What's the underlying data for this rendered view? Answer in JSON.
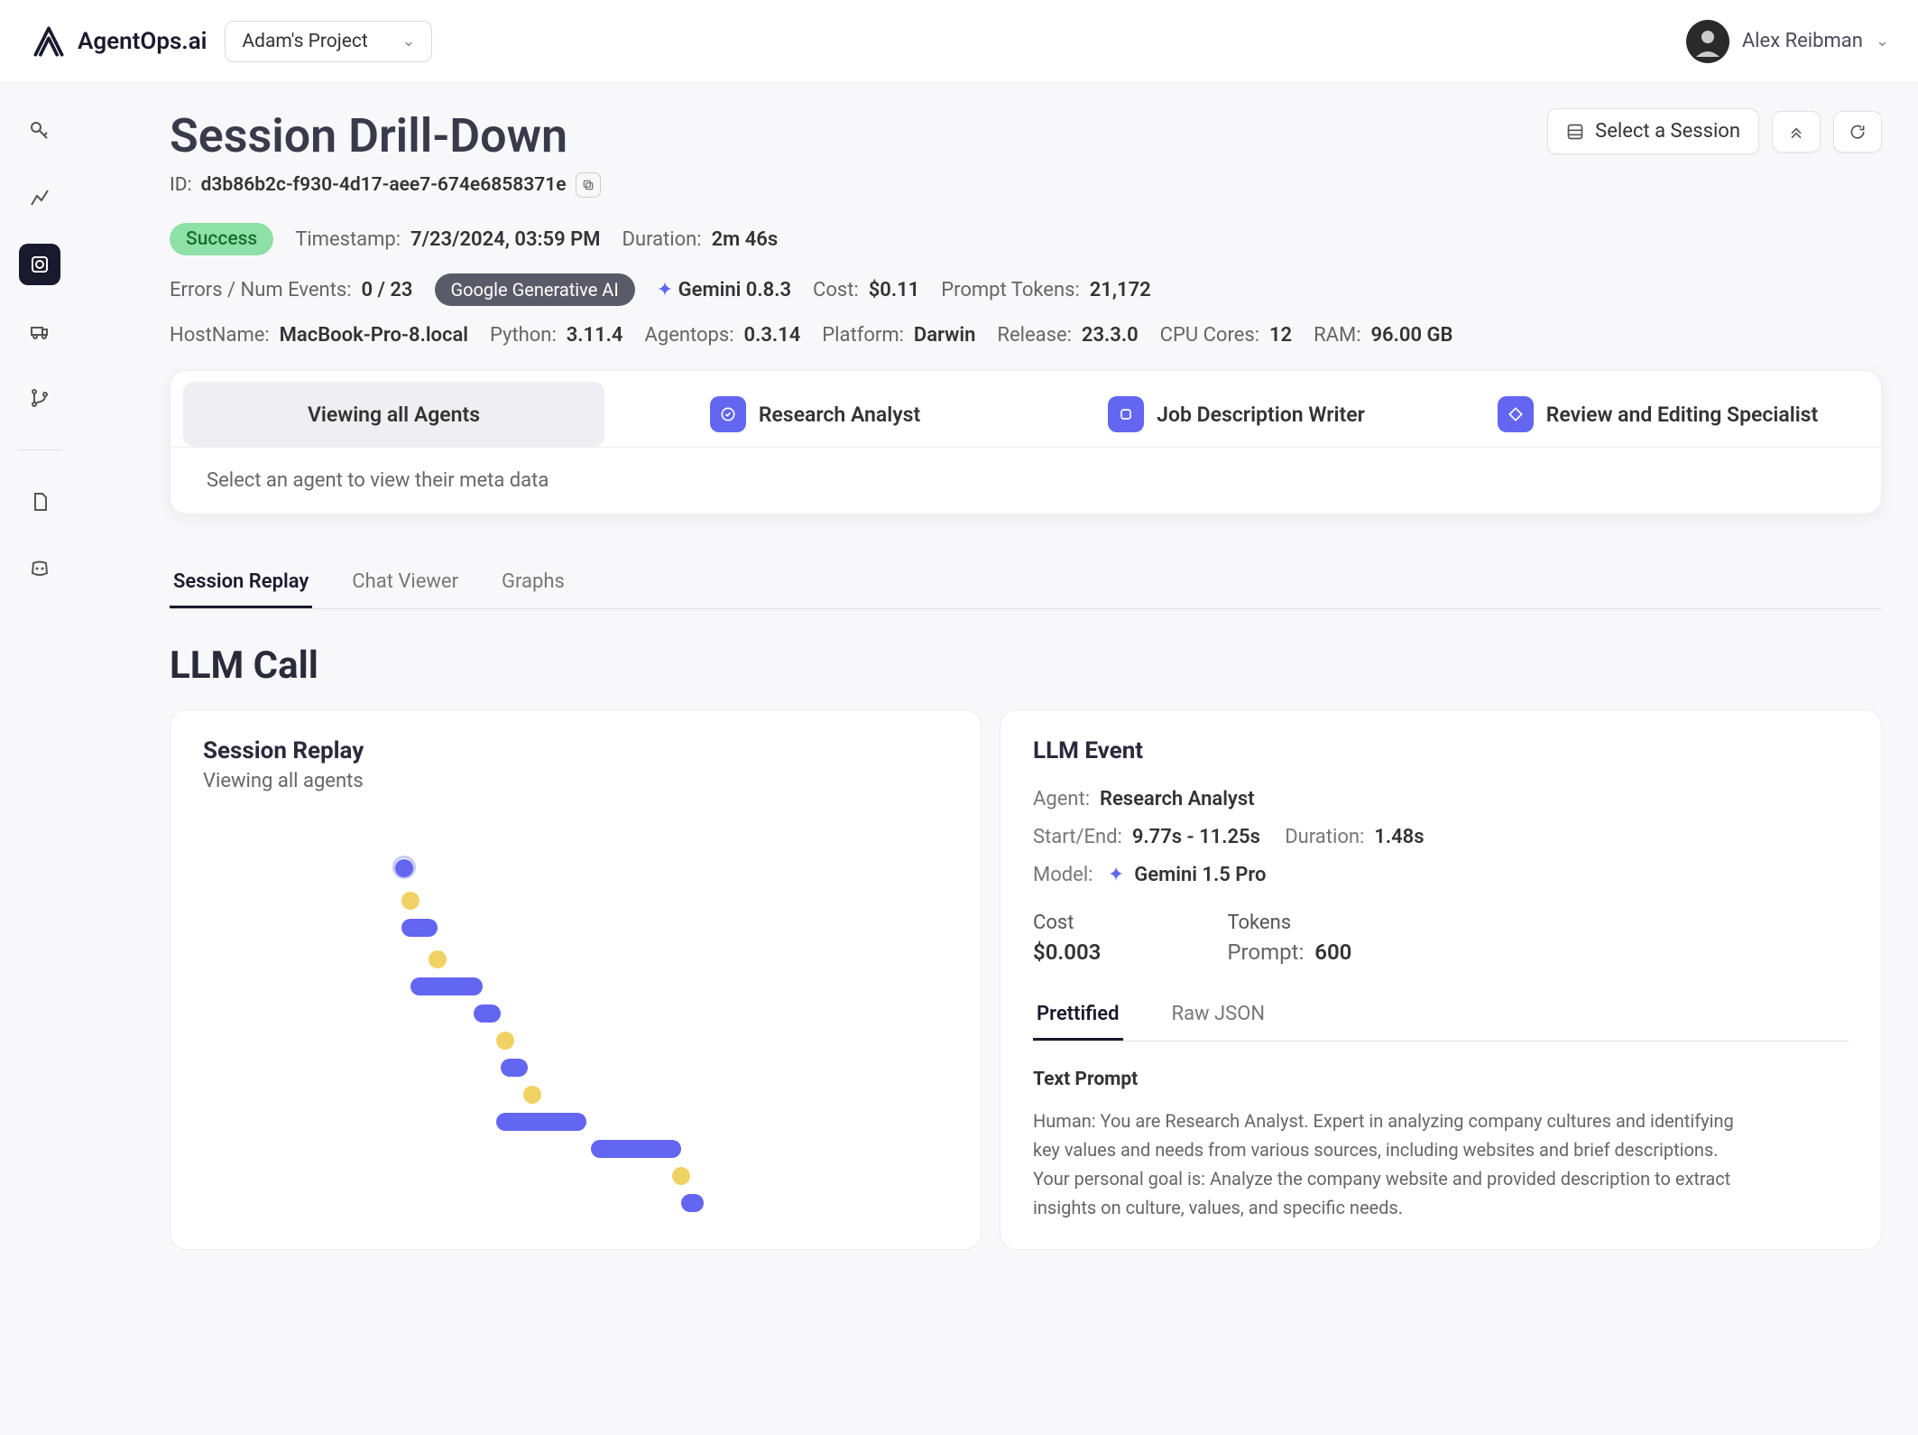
{
  "brand": "AgentOps.ai",
  "project": "Adam's Project",
  "user": "Alex Reibman",
  "page": {
    "title": "Session Drill-Down",
    "id_label": "ID:",
    "id_value": "d3b86b2c-f930-4d17-aee7-674e6858371e",
    "select_session": "Select a Session"
  },
  "status": {
    "badge": "Success",
    "timestamp_label": "Timestamp:",
    "timestamp": "7/23/2024, 03:59 PM",
    "duration_label": "Duration:",
    "duration": "2m 46s"
  },
  "metrics": {
    "errors_label": "Errors / Num Events:",
    "errors": "0 / 23",
    "provider": "Google Generative AI",
    "model": "Gemini 0.8.3",
    "cost_label": "Cost:",
    "cost": "$0.11",
    "prompt_tokens_label": "Prompt Tokens:",
    "prompt_tokens": "21,172"
  },
  "env": {
    "hostname_label": "HostName:",
    "hostname": "MacBook-Pro-8.local",
    "python_label": "Python:",
    "python": "3.11.4",
    "agentops_label": "Agentops:",
    "agentops": "0.3.14",
    "platform_label": "Platform:",
    "platform": "Darwin",
    "release_label": "Release:",
    "release": "23.3.0",
    "cpu_label": "CPU Cores:",
    "cpu": "12",
    "ram_label": "RAM:",
    "ram": "96.00 GB"
  },
  "agents": {
    "all": "Viewing all Agents",
    "a1": "Research Analyst",
    "a2": "Job Description Writer",
    "a3": "Review and Editing Specialist",
    "hint": "Select an agent to view their meta data"
  },
  "subtabs": {
    "t1": "Session Replay",
    "t2": "Chat Viewer",
    "t3": "Graphs"
  },
  "section": "LLM Call",
  "replay": {
    "title": "Session Replay",
    "subtitle": "Viewing all agents"
  },
  "event": {
    "title": "LLM Event",
    "agent_label": "Agent:",
    "agent": "Research Analyst",
    "startend_label": "Start/End:",
    "startend": "9.77s - 11.25s",
    "duration_label": "Duration:",
    "duration": "1.48s",
    "model_label": "Model:",
    "model": "Gemini 1.5 Pro",
    "cost_label": "Cost",
    "cost": "$0.003",
    "tokens_label": "Tokens",
    "prompt_label": "Prompt:",
    "prompt_tokens": "600",
    "tab1": "Prettified",
    "tab2": "Raw JSON",
    "text_prompt_title": "Text Prompt",
    "text_prompt_body": "Human: You are Research Analyst. Expert in analyzing company cultures and identifying key values and needs from various sources, including websites and brief descriptions.\nYour personal goal is: Analyze the company website and provided description to extract insights on culture, values, and specific needs."
  }
}
